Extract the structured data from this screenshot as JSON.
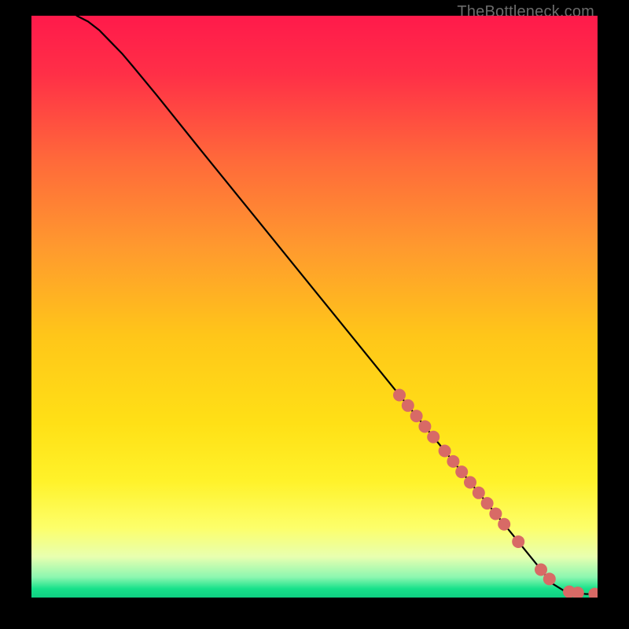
{
  "watermark": "TheBottleneck.com",
  "gradient": {
    "stops": [
      {
        "offset": 0.0,
        "color": "#ff1a4b"
      },
      {
        "offset": 0.1,
        "color": "#ff2f47"
      },
      {
        "offset": 0.25,
        "color": "#ff6a3a"
      },
      {
        "offset": 0.4,
        "color": "#ff9a2e"
      },
      {
        "offset": 0.55,
        "color": "#ffc619"
      },
      {
        "offset": 0.7,
        "color": "#ffe016"
      },
      {
        "offset": 0.8,
        "color": "#fff22a"
      },
      {
        "offset": 0.88,
        "color": "#fdff6a"
      },
      {
        "offset": 0.93,
        "color": "#e8ffb0"
      },
      {
        "offset": 0.965,
        "color": "#8cf7b0"
      },
      {
        "offset": 0.985,
        "color": "#17e18a"
      },
      {
        "offset": 1.0,
        "color": "#0fcf82"
      }
    ]
  },
  "chart_data": {
    "type": "line",
    "title": "",
    "xlabel": "",
    "ylabel": "",
    "xlim": [
      0,
      100
    ],
    "ylim": [
      0,
      100
    ],
    "series": [
      {
        "name": "curve",
        "x": [
          8,
          10,
          12,
          14,
          16,
          18,
          22,
          30,
          40,
          50,
          60,
          70,
          76,
          80,
          84,
          86,
          88,
          90,
          92,
          94,
          96,
          98,
          100
        ],
        "y": [
          100,
          99,
          97.5,
          95.5,
          93.5,
          91.2,
          86.5,
          76.8,
          64.8,
          52.8,
          40.8,
          28.8,
          21.6,
          16.8,
          12.0,
          9.6,
          7.2,
          4.8,
          2.4,
          1.2,
          0.8,
          0.6,
          0.6
        ]
      }
    ],
    "markers": {
      "name": "highlight-points",
      "color": "#d86a66",
      "x": [
        65,
        66.5,
        68,
        69.5,
        71,
        73,
        74.5,
        76,
        77.5,
        79,
        80.5,
        82,
        83.5,
        86,
        90,
        91.5,
        95,
        96.5,
        99.5
      ],
      "y": [
        34.8,
        33.0,
        31.2,
        29.4,
        27.6,
        25.2,
        23.4,
        21.6,
        19.8,
        18.0,
        16.2,
        14.4,
        12.6,
        9.6,
        4.8,
        3.2,
        1.0,
        0.8,
        0.6
      ]
    }
  }
}
